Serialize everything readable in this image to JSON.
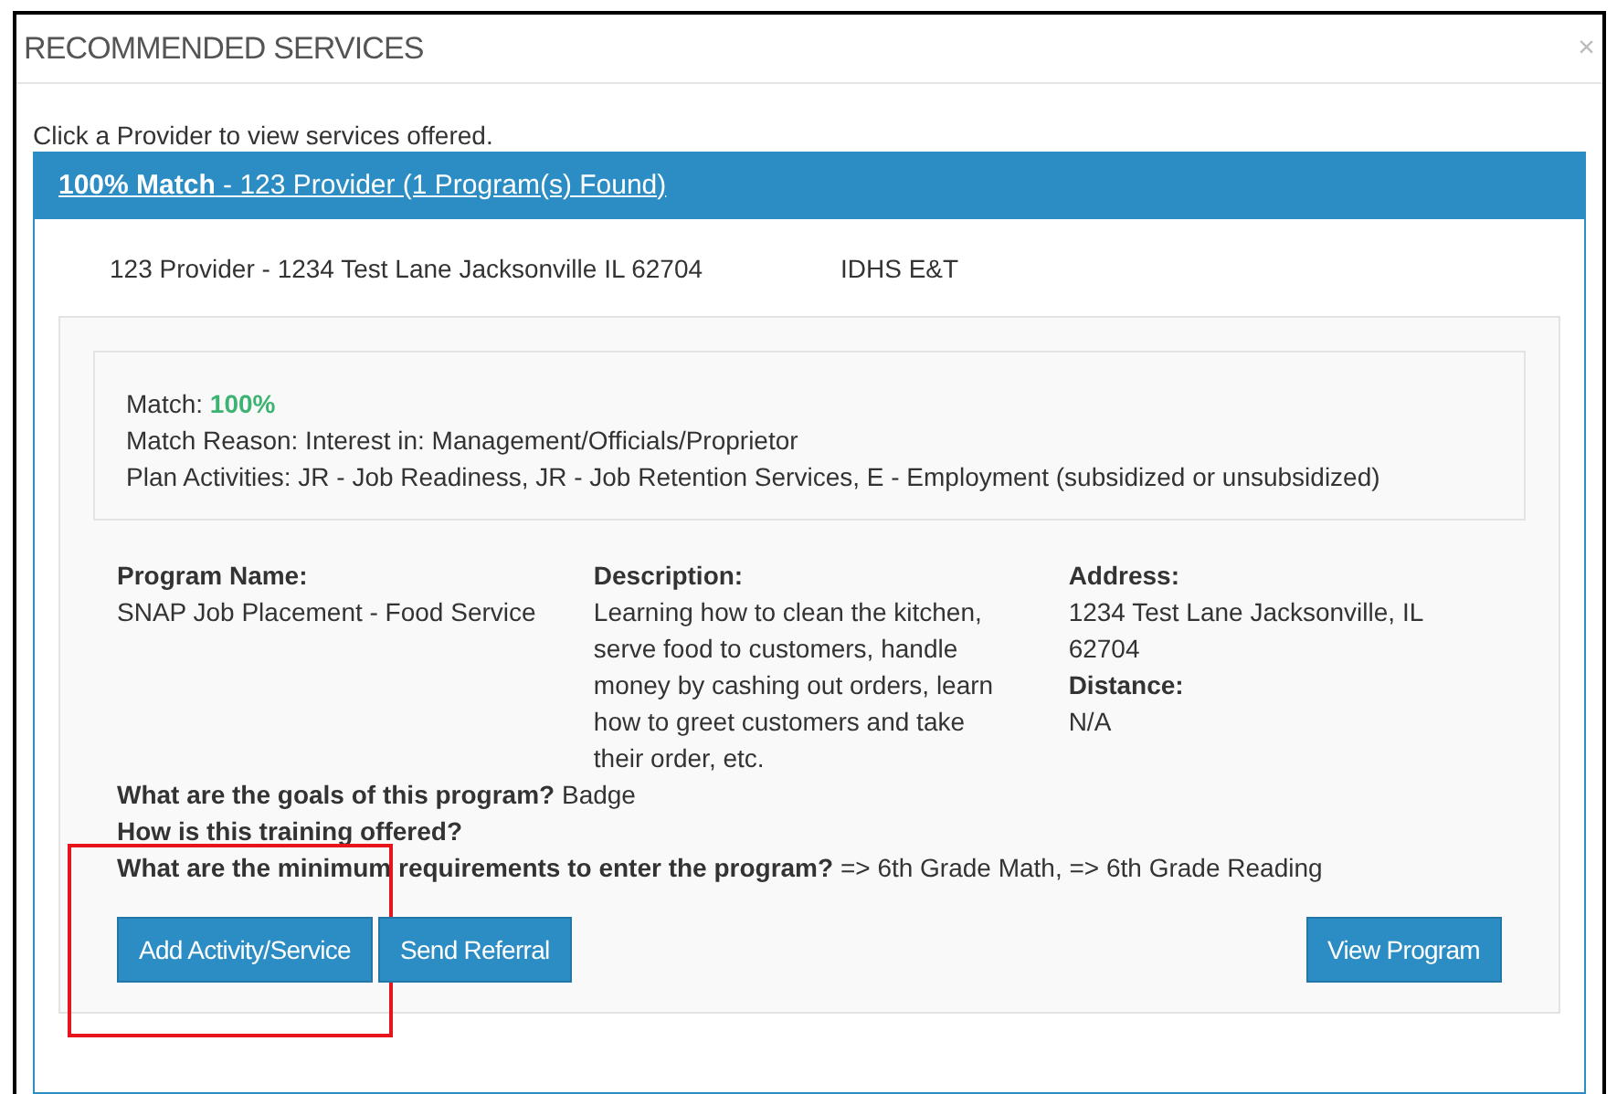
{
  "dialog": {
    "title": "RECOMMENDED SERVICES",
    "close": "×"
  },
  "instruction": "Click a Provider to view services offered.",
  "provider": {
    "match": "100% Match",
    "title": " - 123 Provider (1 Program(s) Found)",
    "address_line": "123 Provider - 1234 Test Lane Jacksonville IL 62704",
    "agency": "IDHS E&T",
    "match_box": {
      "match_label": "Match: ",
      "match_value": "100%",
      "reason": "Match Reason: Interest in: Management/Officials/Proprietor",
      "activities": "Plan Activities: JR - Job Readiness, JR - Job Retention Services, E - Employment (subsidized or unsubsidized)"
    },
    "program": {
      "columns": [
        {
          "label": "Program Name:",
          "value": "SNAP Job Placement - Food Service"
        },
        {
          "label": "Description:",
          "value": "Learning how to clean the kitchen, serve food to customers, handle money by cashing out orders, learn how to greet customers and take their order, etc."
        },
        {
          "label": "Address:",
          "value": "1234 Test Lane Jacksonville, IL 62704",
          "label_2": "Distance:",
          "value_2": "N/A"
        }
      ],
      "questions": [
        {
          "q": "What are the goals of this program?",
          "a": "Badge"
        },
        {
          "q": "How is this training offered?"
        },
        {
          "q": "What are the minimum requirements to enter the program?",
          "a": "=> 6th Grade Math, => 6th Grade Reading"
        }
      ],
      "buttons": [
        {
          "label": "Add Activity/Service",
          "highlighted": true
        },
        {
          "label": "Send Referral",
          "highlighted": false
        },
        {
          "label": "View Program",
          "highlighted": false
        }
      ]
    }
  }
}
